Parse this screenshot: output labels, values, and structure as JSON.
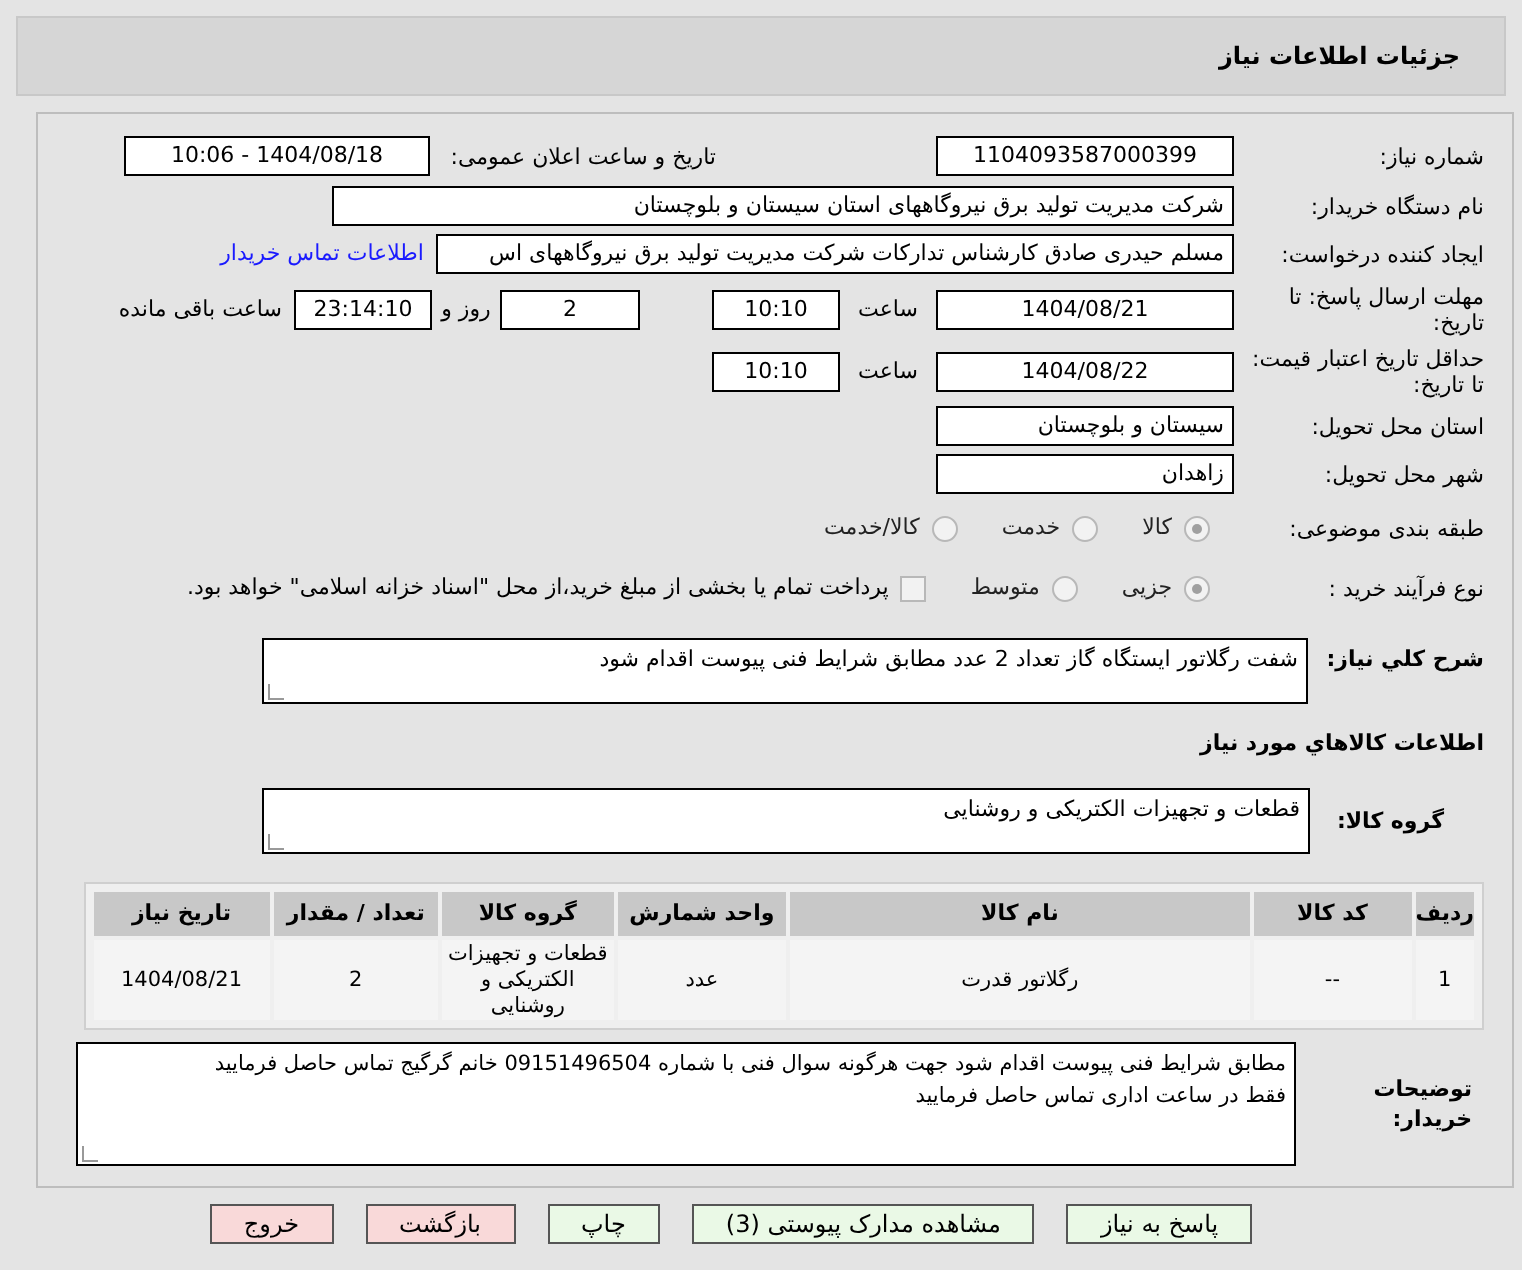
{
  "header": {
    "title": "جزئیات اطلاعات نیاز"
  },
  "need_number": {
    "label": "شماره نیاز:",
    "value": "1104093587000399"
  },
  "announce_datetime": {
    "label": "تاریخ و ساعت اعلان عمومی:",
    "value": "1404/08/18 - 10:06"
  },
  "buyer_org": {
    "label": "نام دستگاه خریدار:",
    "value": "شرکت مدیریت تولید برق نیروگاههای استان سیستان و بلوچستان"
  },
  "requester": {
    "label": "ایجاد کننده درخواست:",
    "value": "مسلم حیدری صادق کارشناس تدارکات شرکت مدیریت تولید برق نیروگاههای اس",
    "link": "اطلاعات تماس خریدار"
  },
  "response_deadline": {
    "label": "مهلت ارسال پاسخ: تا تاریخ:",
    "date": "1404/08/21",
    "time_label": "ساعت",
    "time": "10:10",
    "days": "2",
    "days_label": "روز و",
    "remaining": "23:14:10",
    "remaining_label": "ساعت باقی مانده"
  },
  "price_validity": {
    "label": "حداقل تاریخ اعتبار قیمت: تا تاریخ:",
    "date": "1404/08/22",
    "time_label": "ساعت",
    "time": "10:10"
  },
  "delivery_province": {
    "label": "استان محل تحویل:",
    "value": "سیستان و بلوچستان"
  },
  "delivery_city": {
    "label": "شهر محل تحویل:",
    "value": "زاهدان"
  },
  "category": {
    "label": "طبقه بندی موضوعی:",
    "options": [
      {
        "label": "کالا",
        "selected": true
      },
      {
        "label": "خدمت",
        "selected": false
      },
      {
        "label": "کالا/خدمت",
        "selected": false
      }
    ]
  },
  "purchase_process": {
    "label": "نوع فرآیند خرید :",
    "options": [
      {
        "label": "جزیی",
        "selected": true
      },
      {
        "label": "متوسط",
        "selected": false
      }
    ],
    "treasury_payment": {
      "checked": false,
      "text": "پرداخت تمام یا بخشی از مبلغ خرید،از محل \"اسناد خزانه اسلامی\" خواهد بود."
    }
  },
  "description": {
    "label": "شرح کلي نياز:",
    "value": "شفت  رگلاتور ایستگاه گاز  تعداد  2 عدد   مطابق شرایط فنی پیوست اقدام شود"
  },
  "goods_section": {
    "title": "اطلاعات کالاهاي مورد نياز"
  },
  "goods_group": {
    "label": "گروه کالا:",
    "value": "قطعات و تجهیزات الکتریکی و روشنایی"
  },
  "table": {
    "columns": [
      "ردیف",
      "کد کالا",
      "نام کالا",
      "واحد شمارش",
      "گروه کالا",
      "تعداد / مقدار",
      "تاریخ نیاز"
    ],
    "rows": [
      [
        "1",
        "--",
        "رگلاتور قدرت",
        "عدد",
        "قطعات و تجهیزات الکتریکی و روشنایی",
        "2",
        "1404/08/21"
      ]
    ]
  },
  "buyer_notes": {
    "label": "توضیحات خریدار:",
    "value": "مطابق شرایط فنی پیوست اقدام شود جهت هرگونه سوال فنی با شماره 09151496504 خانم گرگیج تماس حاصل فرمایید\nفقط در ساعت اداری تماس حاصل فرمایید"
  },
  "buttons": [
    {
      "label": "پاسخ به نیاز",
      "kind": "green"
    },
    {
      "label": "مشاهده مدارک پیوستی (3)",
      "kind": "green"
    },
    {
      "label": "چاپ",
      "kind": "green"
    },
    {
      "label": "بازگشت",
      "kind": "red"
    },
    {
      "label": "خروج",
      "kind": "red"
    }
  ]
}
